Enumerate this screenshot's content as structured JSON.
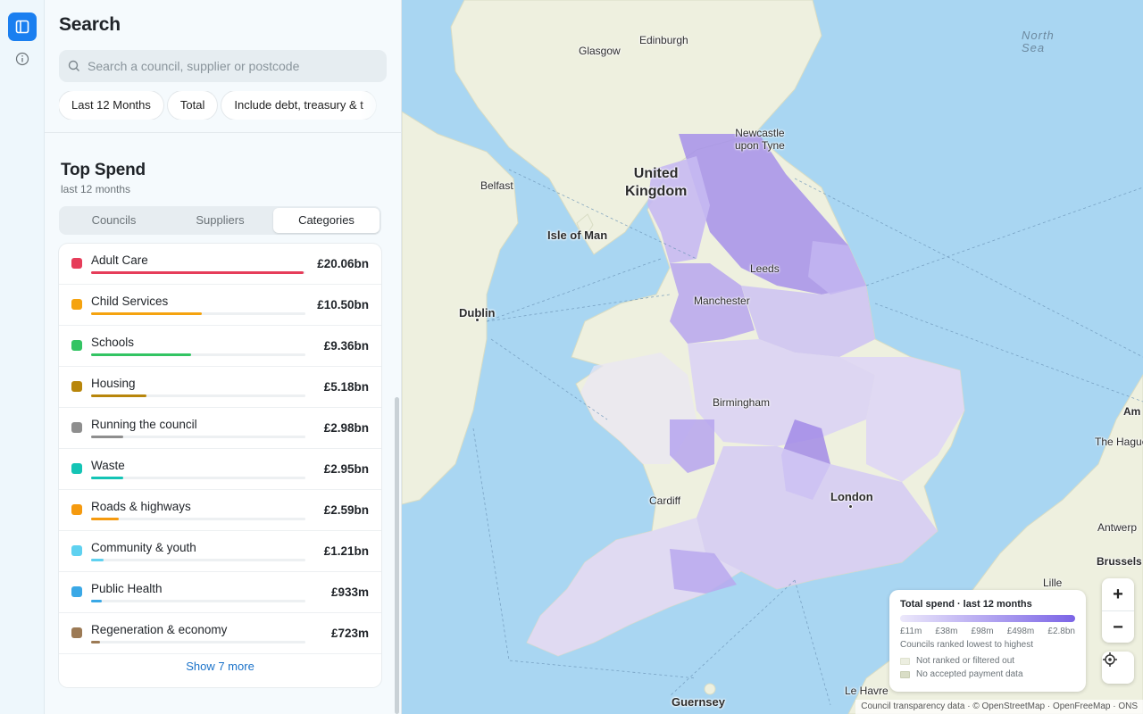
{
  "sidebar": {
    "title": "Search",
    "search": {
      "placeholder": "Search a council, supplier or postcode",
      "value": ""
    },
    "filters": [
      "Last 12 Months",
      "Total",
      "Include debt, treasury & t"
    ]
  },
  "top_spend": {
    "title": "Top Spend",
    "subtitle": "last 12 months",
    "tabs": [
      "Councils",
      "Suppliers",
      "Categories"
    ],
    "active_tab": "Categories",
    "items": [
      {
        "label": "Adult Care",
        "value": "£20.06bn",
        "share": 1.0,
        "color": "#e63d5a"
      },
      {
        "label": "Child Services",
        "value": "£10.50bn",
        "share": 0.52,
        "color": "#f5a30f"
      },
      {
        "label": "Schools",
        "value": "£9.36bn",
        "share": 0.47,
        "color": "#33c463"
      },
      {
        "label": "Housing",
        "value": "£5.18bn",
        "share": 0.26,
        "color": "#b8860b"
      },
      {
        "label": "Running the council",
        "value": "£2.98bn",
        "share": 0.15,
        "color": "#8e8e8e"
      },
      {
        "label": "Waste",
        "value": "£2.95bn",
        "share": 0.15,
        "color": "#14c4b5"
      },
      {
        "label": "Roads & highways",
        "value": "£2.59bn",
        "share": 0.13,
        "color": "#f59a0f"
      },
      {
        "label": "Community & youth",
        "value": "£1.21bn",
        "share": 0.06,
        "color": "#5fd1f0"
      },
      {
        "label": "Public Health",
        "value": "£933m",
        "share": 0.05,
        "color": "#3aa8e6"
      },
      {
        "label": "Regeneration & economy",
        "value": "£723m",
        "share": 0.04,
        "color": "#9c7a55"
      }
    ],
    "show_more": "Show 7 more"
  },
  "map": {
    "labels": {
      "north_sea": "North\nSea",
      "united_kingdom": "United\nKingdom",
      "isle_of_man": "Isle of Man",
      "guernsey": "Guernsey",
      "dublin": "Dublin",
      "london": "London",
      "edinburgh": "Edinburgh",
      "glasgow": "Glasgow",
      "newcastle": "Newcastle\nupon Tyne",
      "belfast": "Belfast",
      "leeds": "Leeds",
      "manchester": "Manchester",
      "birmingham": "Birmingham",
      "cardiff": "Cardiff",
      "le_havre": "Le Havre",
      "the_hague": "The Hague",
      "antwerp": "Antwerp",
      "brussels": "Brussels",
      "lille": "Lille",
      "amsterdam": "Am"
    },
    "legend": {
      "title": "Total spend · last 12 months",
      "ticks": [
        "£11m",
        "£38m",
        "£98m",
        "£498m",
        "£2.8bn"
      ],
      "note": "Councils ranked lowest to highest",
      "not_ranked": "Not ranked or filtered out",
      "no_data": "No accepted payment data",
      "color_low": "#ece8fb",
      "color_high": "#7b64e6"
    },
    "controls": {
      "zoom_in": "+",
      "zoom_out": "−"
    },
    "attribution": "Council transparency data · © OpenStreetMap · OpenFreeMap · ONS"
  }
}
